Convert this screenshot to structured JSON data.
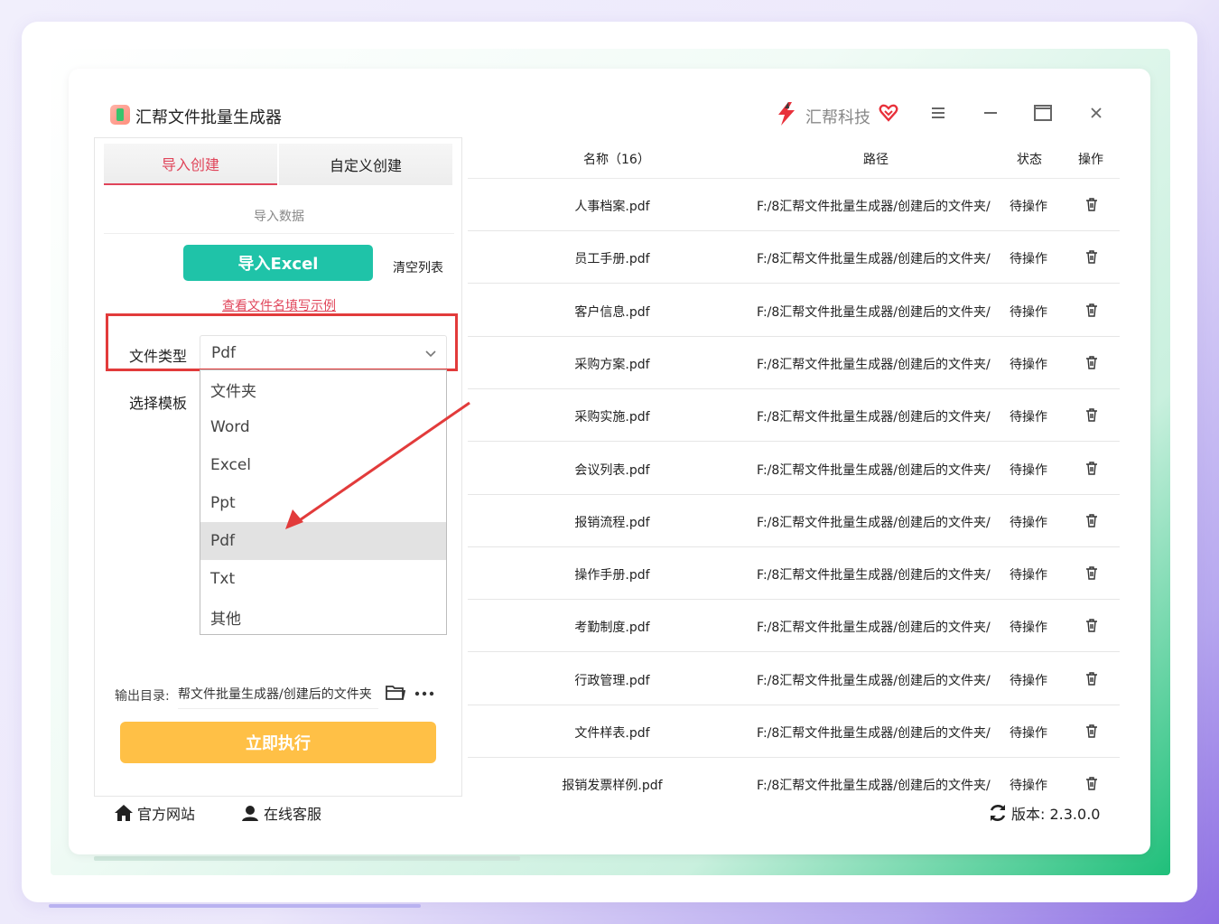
{
  "app": {
    "title": "汇帮文件批量生成器",
    "brand": "汇帮科技"
  },
  "tabs": [
    {
      "label": "导入创建",
      "active": true
    },
    {
      "label": "自定义创建",
      "active": false
    }
  ],
  "left": {
    "section_label": "导入数据",
    "import_button": "导入Excel",
    "clear_list": "清空列表",
    "example_link": "查看文件名填写示例",
    "file_type_label": "文件类型",
    "file_type_value": "Pdf",
    "template_label": "选择模板",
    "dropdown_options": [
      "文件夹",
      "Word",
      "Excel",
      "Ppt",
      "Pdf",
      "Txt",
      "其他"
    ],
    "selected_option": "Pdf",
    "output_label": "输出目录:",
    "output_value": "帮文件批量生成器/创建后的文件夹",
    "run_button": "立即执行"
  },
  "table": {
    "headers": {
      "name": "名称（16）",
      "path": "路径",
      "status": "状态",
      "action": "操作"
    },
    "rows": [
      {
        "name": "人事档案.pdf",
        "path": "F:/8汇帮文件批量生成器/创建后的文件夹/",
        "status": "待操作"
      },
      {
        "name": "员工手册.pdf",
        "path": "F:/8汇帮文件批量生成器/创建后的文件夹/",
        "status": "待操作"
      },
      {
        "name": "客户信息.pdf",
        "path": "F:/8汇帮文件批量生成器/创建后的文件夹/",
        "status": "待操作"
      },
      {
        "name": "采购方案.pdf",
        "path": "F:/8汇帮文件批量生成器/创建后的文件夹/",
        "status": "待操作"
      },
      {
        "name": "采购实施.pdf",
        "path": "F:/8汇帮文件批量生成器/创建后的文件夹/",
        "status": "待操作"
      },
      {
        "name": "会议列表.pdf",
        "path": "F:/8汇帮文件批量生成器/创建后的文件夹/",
        "status": "待操作"
      },
      {
        "name": "报销流程.pdf",
        "path": "F:/8汇帮文件批量生成器/创建后的文件夹/",
        "status": "待操作"
      },
      {
        "name": "操作手册.pdf",
        "path": "F:/8汇帮文件批量生成器/创建后的文件夹/",
        "status": "待操作"
      },
      {
        "name": "考勤制度.pdf",
        "path": "F:/8汇帮文件批量生成器/创建后的文件夹/",
        "status": "待操作"
      },
      {
        "name": "行政管理.pdf",
        "path": "F:/8汇帮文件批量生成器/创建后的文件夹/",
        "status": "待操作"
      },
      {
        "name": "文件样表.pdf",
        "path": "F:/8汇帮文件批量生成器/创建后的文件夹/",
        "status": "待操作"
      },
      {
        "name": "报销发票样例.pdf",
        "path": "F:/8汇帮文件批量生成器/创建后的文件夹/",
        "status": "待操作"
      }
    ]
  },
  "footer": {
    "website": "官方网站",
    "support": "在线客服",
    "version": "版本: 2.3.0.0"
  },
  "colors": {
    "accent_red": "#e0455a",
    "import_teal": "#1fc3a8",
    "run_yellow": "#ffc046",
    "highlight_red": "#e23b3b"
  },
  "icons": [
    "app-logo-icon",
    "brand-logo-icon",
    "heart-icon",
    "menu-icon",
    "minimize-icon",
    "maximize-icon",
    "close-icon",
    "chevron-down-icon",
    "folder-icon",
    "more-icon",
    "trash-icon",
    "home-icon",
    "support-icon",
    "refresh-icon"
  ]
}
